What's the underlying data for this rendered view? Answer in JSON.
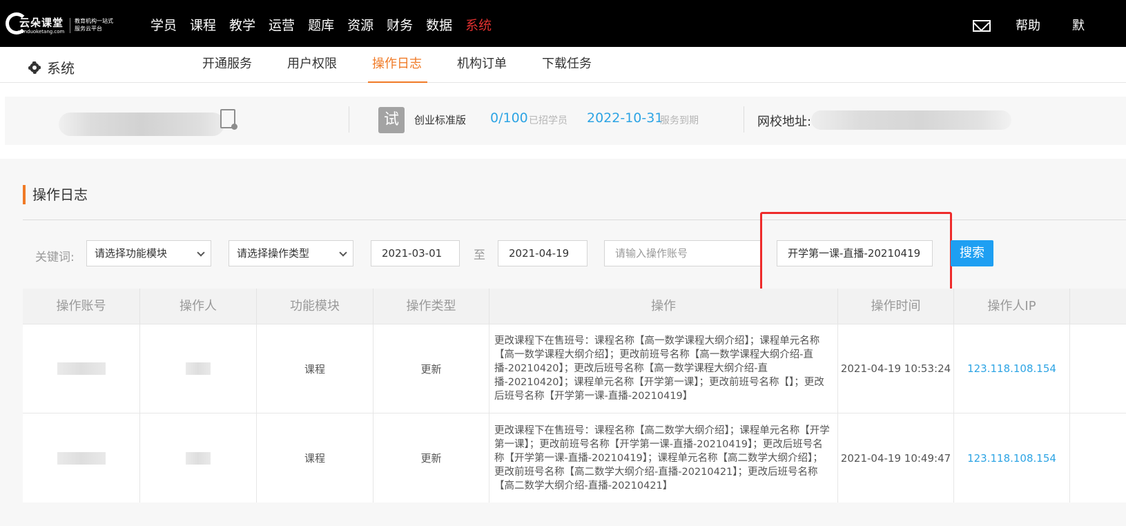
{
  "brand": {
    "name": "云朵课堂",
    "domain": "yunduoketang.com",
    "slogan": "教育机构一站式服务云平台"
  },
  "top_nav": {
    "items": [
      "学员",
      "课程",
      "教学",
      "运营",
      "题库",
      "资源",
      "财务",
      "数据",
      "系统"
    ],
    "active_index": 8,
    "help": "帮助",
    "user": "默"
  },
  "sub_nav": {
    "section": "系统",
    "tabs": [
      "开通服务",
      "用户权限",
      "操作日志",
      "机构订单",
      "下载任务"
    ],
    "active_index": 2
  },
  "info_bar": {
    "trial_badge": "试",
    "edition": "创业标准版",
    "students_value": "0/100",
    "students_label": "已招学员",
    "expire_value": "2022-10-31",
    "expire_label": "服务到期",
    "school_label": "网校地址:"
  },
  "log_panel": {
    "title": "操作日志",
    "filters": {
      "keyword_label": "关键词:",
      "module_select": "请选择功能模块",
      "type_select": "请选择操作类型",
      "start_date": "2021-03-01",
      "to_label": "至",
      "end_date": "2021-04-19",
      "account_placeholder": "请输入操作账号",
      "keyword_value": "开学第一课-直播-20210419",
      "search_button": "搜索"
    },
    "columns": [
      "操作账号",
      "操作人",
      "功能模块",
      "操作类型",
      "操作",
      "操作时间",
      "操作人IP"
    ],
    "rows": [
      {
        "module": "课程",
        "type": "更新",
        "operation": "更改课程下在售班号：课程名称【高一数学课程大纲介绍】；课程单元名称【高一数学课程大纲介绍】；更改前班号名称【高一数学课程大纲介绍-直播-20210420】；更改后班号名称【高一数学课程大纲介绍-直播-20210420】；课程单元名称【开学第一课】；更改前班号名称【】；更改后班号名称【开学第一课-直播-20210419】",
        "time": "2021-04-19 10:53:24",
        "ip": "123.118.108.154"
      },
      {
        "module": "课程",
        "type": "更新",
        "operation": "更改课程下在售班号：课程名称【高二数学大纲介绍】；课程单元名称【开学第一课】；更改前班号名称【开学第一课-直播-20210419】；更改后班号名称【开学第一课-直播-20210419】；课程单元名称【高二数学大纲介绍】；更改前班号名称【高二数学大纲介绍-直播-20210421】；更改后班号名称【高二数学大纲介绍-直播-20210421】",
        "time": "2021-04-19 10:49:47",
        "ip": "123.118.108.154"
      }
    ]
  }
}
